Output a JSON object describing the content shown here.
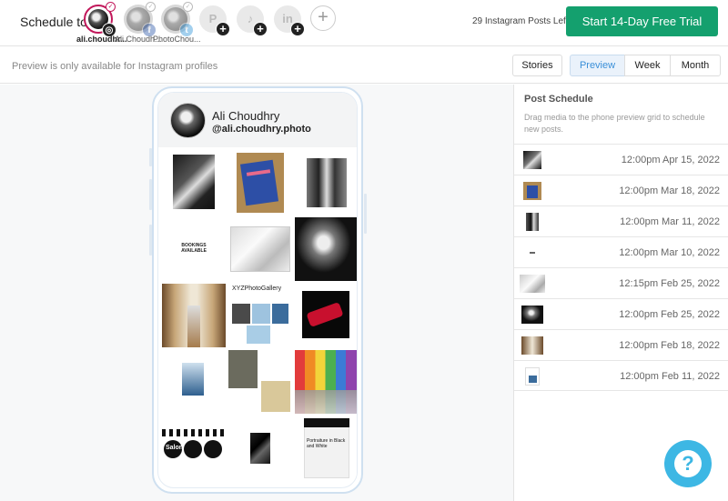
{
  "header": {
    "schedule_label": "Schedule to",
    "profiles": [
      {
        "name": "ali.choudhr...",
        "network": "instagram",
        "active": true
      },
      {
        "name": "Ali Choudh...",
        "network": "facebook",
        "active": false
      },
      {
        "name": "PhotoChou...",
        "network": "twitter",
        "active": false
      },
      {
        "name": "",
        "network": "pinterest",
        "active": false
      },
      {
        "name": "",
        "network": "tiktok",
        "active": false
      },
      {
        "name": "",
        "network": "linkedin",
        "active": false
      }
    ],
    "posts_left": "29 Instagram Posts Left",
    "trial_button": "Start 14-Day Free Trial",
    "accent_color": "#14a06e"
  },
  "subbar": {
    "preview_note": "Preview is only available for Instagram profiles",
    "stories_label": "Stories",
    "views": [
      "Preview",
      "Week",
      "Month"
    ],
    "active_view": "Preview"
  },
  "phone": {
    "name": "Ali Choudhry",
    "handle": "@ali.choudhry.photo",
    "grid_text": {
      "bookings": "BOOKINGS AVAILABLE",
      "gallery": "XYZPhotoGallery",
      "salon": "Salon",
      "portraiture": "Portraiture in Black and White"
    }
  },
  "schedule": {
    "title": "Post Schedule",
    "description": "Drag media to the phone preview grid to schedule new posts.",
    "items": [
      {
        "time": "12:00pm Apr 15, 2022",
        "thumb": "bw-figure"
      },
      {
        "time": "12:00pm Mar 18, 2022",
        "thumb": "book-cover"
      },
      {
        "time": "12:00pm Mar 11, 2022",
        "thumb": "bw-portrait"
      },
      {
        "time": "12:00pm Mar 10, 2022",
        "thumb": "text-card"
      },
      {
        "time": "12:15pm Feb 25, 2022",
        "thumb": "grey-abstract"
      },
      {
        "time": "12:00pm Feb 25, 2022",
        "thumb": "bw-torso"
      },
      {
        "time": "12:00pm Feb 18, 2022",
        "thumb": "gallery-hall"
      },
      {
        "time": "12:00pm Feb 11, 2022",
        "thumb": "poster"
      }
    ]
  },
  "help_icon": "question-icon"
}
